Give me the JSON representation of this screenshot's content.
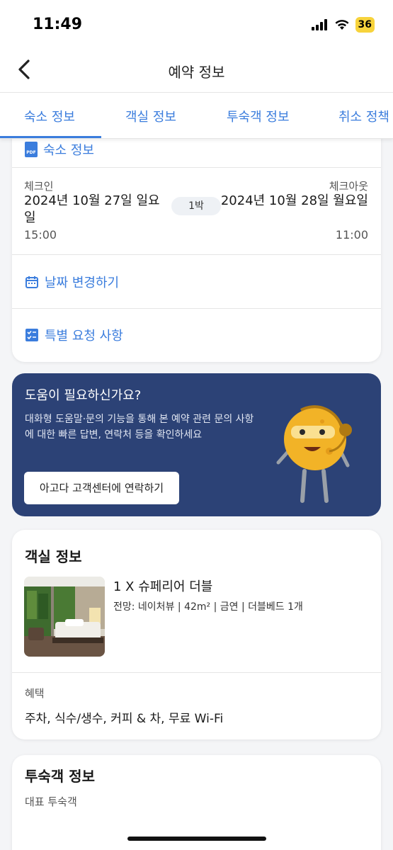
{
  "status": {
    "time": "11:49",
    "battery": "36"
  },
  "nav": {
    "title": "예약 정보"
  },
  "tabs": [
    {
      "label": "숙소 정보"
    },
    {
      "label": "객실 정보"
    },
    {
      "label": "투숙객 정보"
    },
    {
      "label": "취소 정책"
    }
  ],
  "stay": {
    "pdf_label": "숙소 정보",
    "checkin_label": "체크인",
    "checkin_date": "2024년 10월 27일 일요일",
    "checkin_time": "15:00",
    "nights": "1박",
    "checkout_label": "체크아웃",
    "checkout_date": "2024년 10월 28일 월요일",
    "checkout_time": "11:00",
    "change_dates": "날짜 변경하기",
    "special_request": "특별 요청 사항"
  },
  "help": {
    "title": "도움이 필요하신가요?",
    "description": "대화형 도움말·문의 기능을 통해 본 예약 관련 문의 사항에 대한 빠른 답변, 연락처 등을 확인하세요",
    "button": "아고다 고객센터에 연락하기"
  },
  "room": {
    "section_title": "객실 정보",
    "name": "1 X 슈페리어 더블",
    "details": "전망: 네이처뷰 | 42m² | 금연 | 더블베드 1개",
    "benefit_label": "혜택",
    "benefit_value": "주차, 식수/생수, 커피 & 차, 무료 Wi-Fi"
  },
  "guest": {
    "section_title": "투숙객 정보",
    "sub_label": "대표 투숙객"
  },
  "colors": {
    "accent": "#3b7ddd",
    "help_bg": "#2c4276"
  }
}
